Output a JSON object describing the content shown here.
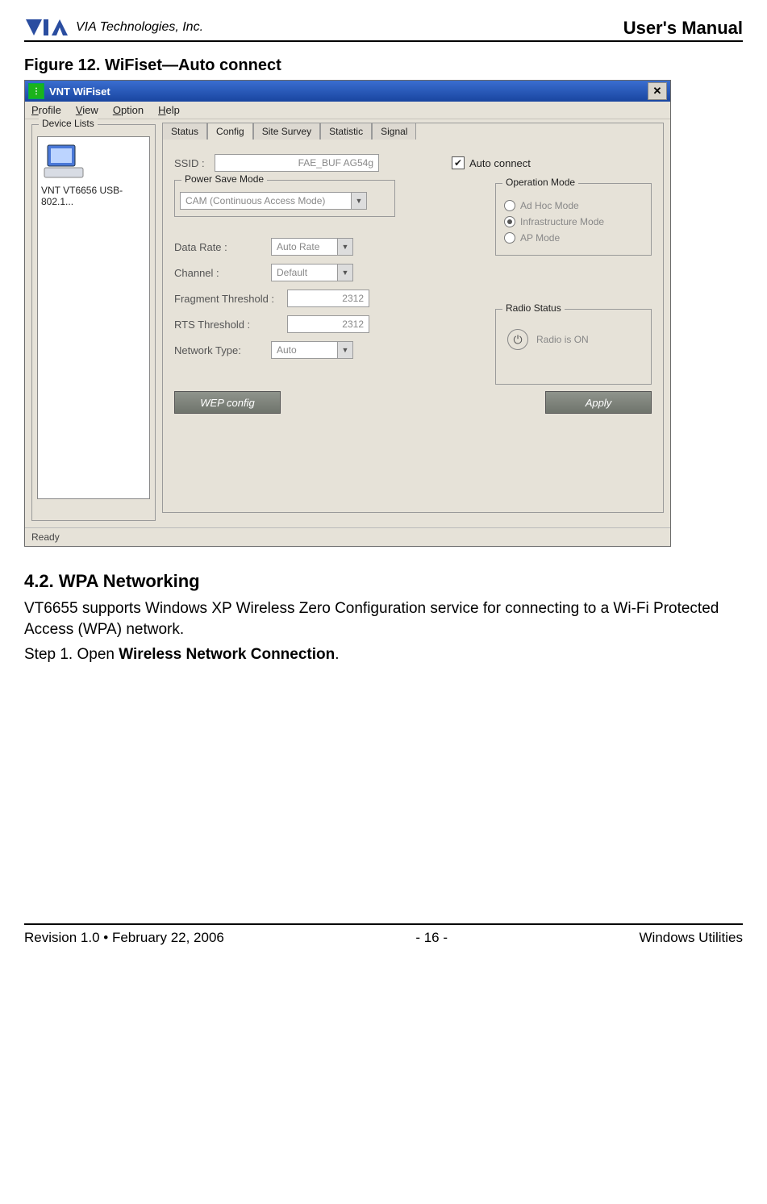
{
  "header": {
    "company": "VIA Technologies, Inc.",
    "manual": "User's Manual"
  },
  "figure_caption": "Figure 12. WiFiset—Auto connect",
  "window": {
    "title": "VNT WiFiset",
    "menus": {
      "profile": "Profile",
      "view": "View",
      "option": "Option",
      "help": "Help"
    },
    "device_group": "Device Lists",
    "device_name": "VNT VT6656 USB-802.1...",
    "tabs": {
      "status": "Status",
      "config": "Config",
      "site": "Site Survey",
      "stat": "Statistic",
      "signal": "Signal"
    },
    "config": {
      "ssid_label": "SSID :",
      "ssid_value": "FAE_BUF AG54g",
      "auto_connect": "Auto connect",
      "psm_group": "Power Save Mode",
      "psm_value": "CAM (Continuous Access Mode)",
      "op_group": "Operation Mode",
      "op_adhoc": "Ad Hoc Mode",
      "op_infra": "Infrastructure Mode",
      "op_ap": "AP Mode",
      "data_rate_label": "Data Rate :",
      "data_rate_value": "Auto Rate",
      "channel_label": "Channel :",
      "channel_value": "Default",
      "frag_label": "Fragment Threshold :",
      "frag_value": "2312",
      "rts_label": "RTS Threshold :",
      "rts_value": "2312",
      "nettype_label": "Network Type:",
      "nettype_value": "Auto",
      "radio_group": "Radio Status",
      "radio_value": "Radio is ON",
      "btn_wep": "WEP config",
      "btn_apply": "Apply"
    },
    "statusbar": "Ready"
  },
  "section": {
    "heading": "4.2. WPA Networking",
    "p1": "VT6655 supports Windows XP Wireless Zero Configuration service for connecting to a Wi-Fi Protected Access (WPA) network.",
    "p2_pre": "Step 1. Open ",
    "p2_bold": "Wireless Network Connection",
    "p2_post": "."
  },
  "footer": {
    "left": "Revision 1.0 • February 22, 2006",
    "center": "- 16 -",
    "right": "Windows Utilities"
  }
}
